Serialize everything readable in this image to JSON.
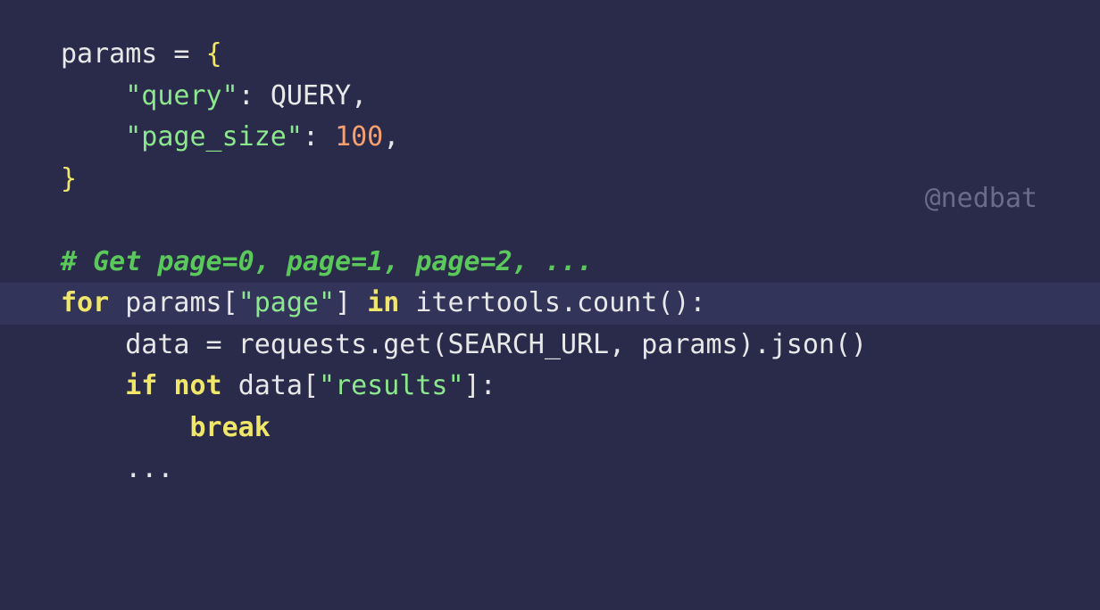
{
  "watermark": "@nedbat",
  "code": {
    "l1": {
      "params": "params",
      "eq": " = ",
      "brace": "{"
    },
    "l2": {
      "indent": "    ",
      "str": "\"query\"",
      "colon": ": ",
      "val": "QUERY",
      "comma": ","
    },
    "l3": {
      "indent": "    ",
      "str": "\"page_size\"",
      "colon": ": ",
      "num": "100",
      "comma": ","
    },
    "l4": {
      "brace": "}"
    },
    "l5": {
      "blank": " "
    },
    "l6": {
      "comment": "# Get page=0, page=1, page=2, ..."
    },
    "l7": {
      "kw_for": "for",
      "sp1": " ",
      "ident": "params",
      "bracket_open": "[",
      "str": "\"page\"",
      "bracket_close": "]",
      "sp2": " ",
      "kw_in": "in",
      "sp3": " ",
      "call": "itertools.count():"
    },
    "l8": {
      "indent": "    ",
      "lhs": "data = requests.get(SEARCH_URL, params).json()"
    },
    "l9": {
      "indent": "    ",
      "kw_if": "if",
      "sp1": " ",
      "kw_not": "not",
      "sp2": " ",
      "ident": "data",
      "bracket_open": "[",
      "str": "\"results\"",
      "bracket_close": "]",
      "colon": ":"
    },
    "l10": {
      "indent": "        ",
      "kw_break": "break"
    },
    "l11": {
      "indent": "    ",
      "dots": "..."
    }
  }
}
